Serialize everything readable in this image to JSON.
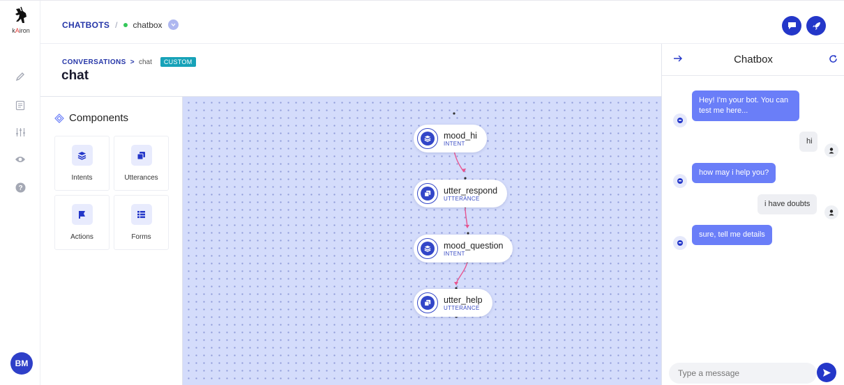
{
  "brand": {
    "logo_text_pre": "k",
    "logo_text_accent": "A",
    "logo_text_post": "iron"
  },
  "topbar": {
    "breadcrumb_root": "CHATBOTS",
    "breadcrumb_sep": "/",
    "bot_name": "chatbox"
  },
  "page": {
    "crumb_section": "CONVERSATIONS",
    "crumb_arrow": ">",
    "crumb_current": "chat",
    "badge": "CUSTOM",
    "title": "chat"
  },
  "components": {
    "title": "Components",
    "items": [
      {
        "label": "Intents",
        "icon": "layers-icon"
      },
      {
        "label": "Utterances",
        "icon": "stack-icon"
      },
      {
        "label": "Actions",
        "icon": "flag-icon"
      },
      {
        "label": "Forms",
        "icon": "list-icon"
      }
    ]
  },
  "flow": {
    "nodes": [
      {
        "name": "mood_hi",
        "type": "INTENT"
      },
      {
        "name": "utter_respond",
        "type": "UTTERANCE"
      },
      {
        "name": "mood_question",
        "type": "INTENT"
      },
      {
        "name": "utter_help",
        "type": "UTTERANCE"
      }
    ]
  },
  "chatbox": {
    "title": "Chatbox",
    "messages": [
      {
        "from": "bot",
        "text": "Hey! I'm your bot. You can test me here..."
      },
      {
        "from": "user",
        "text": "hi"
      },
      {
        "from": "bot",
        "text": "how may i help you?"
      },
      {
        "from": "user",
        "text": "i have doubts"
      },
      {
        "from": "bot",
        "text": "sure, tell me details"
      }
    ],
    "input_placeholder": "Type a message"
  },
  "user": {
    "initials": "BM"
  },
  "colors": {
    "primary": "#2437c9",
    "bot_bubble": "#6a7ef8",
    "canvas": "#d4dcfb",
    "edge": "#e8558f",
    "badge": "#17a2b8"
  }
}
